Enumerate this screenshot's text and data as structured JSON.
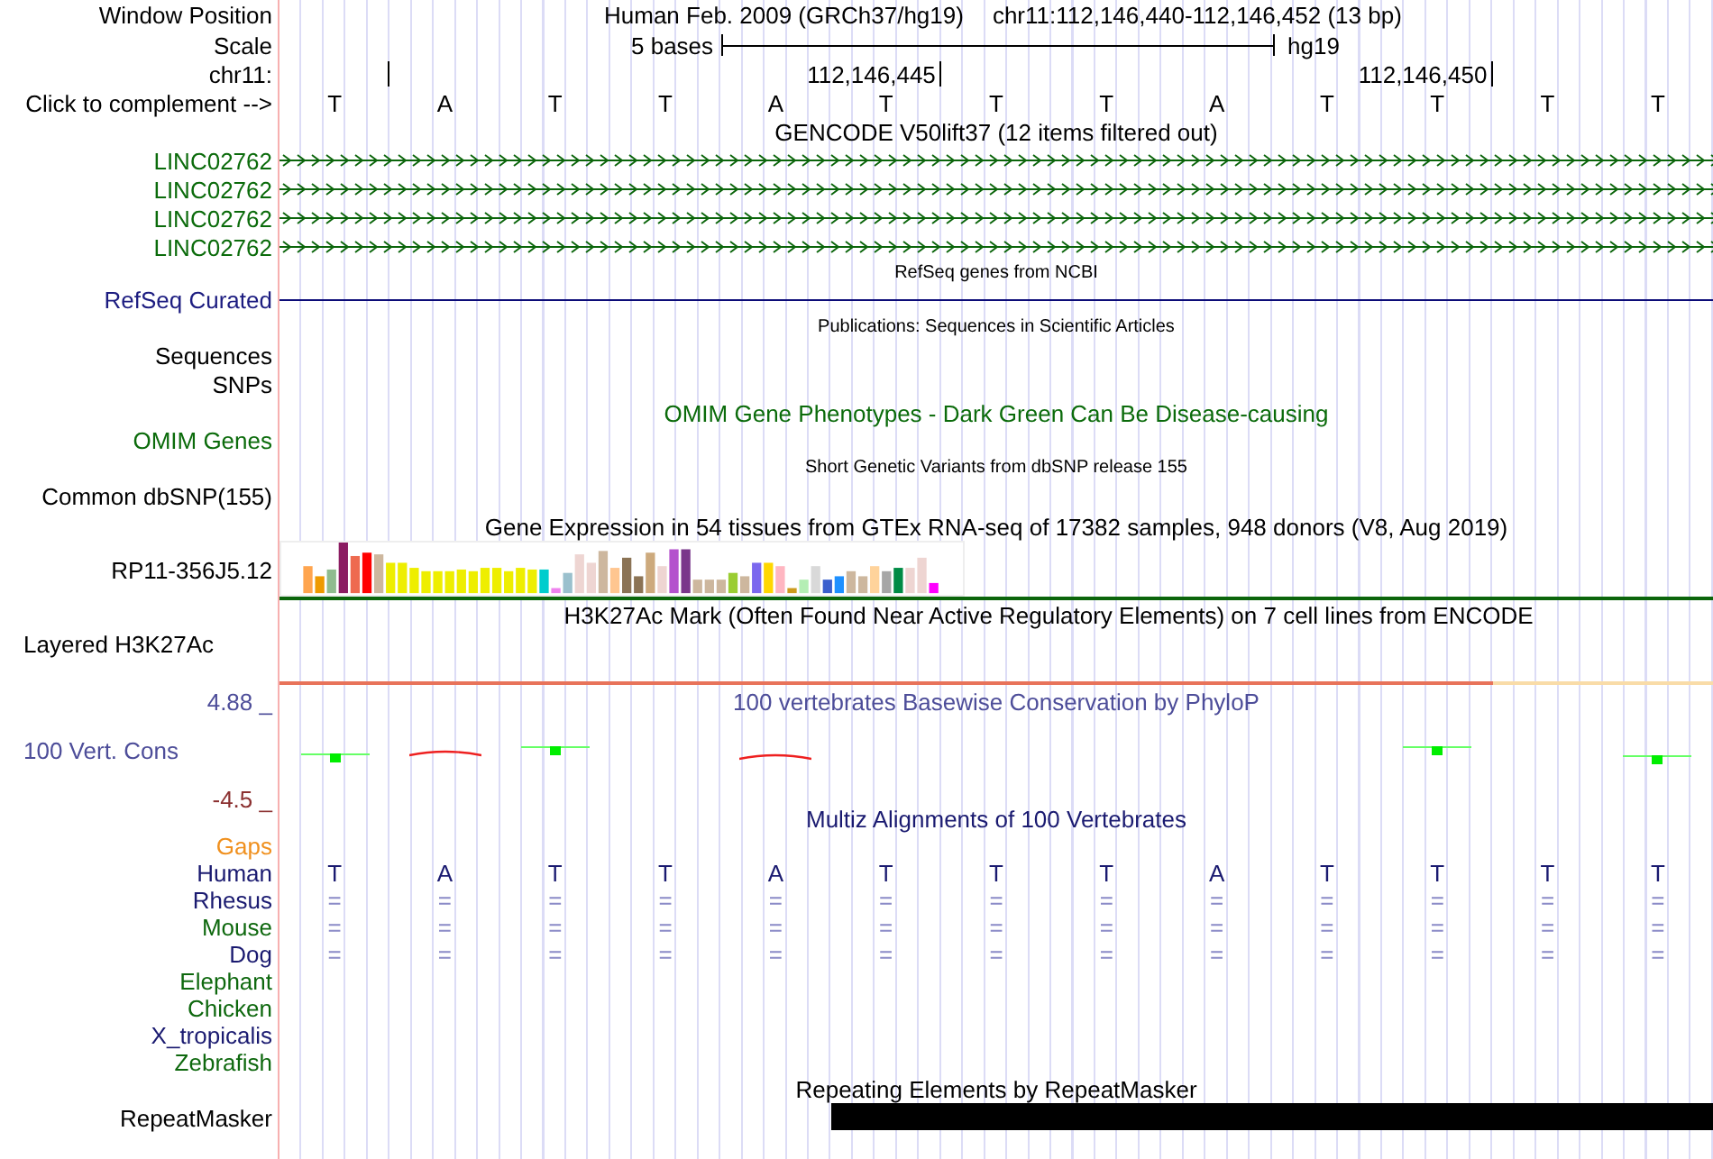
{
  "header": {
    "label": "Window Position",
    "assembly": "Human Feb. 2009 (GRCh37/hg19)",
    "range": "chr11:112,146,440-112,146,452 (13 bp)"
  },
  "scale": {
    "label": "Scale",
    "span": "5 bases",
    "assembly": "hg19"
  },
  "ruler": {
    "label": "chr11:",
    "tick_labels": [
      "112,146,445",
      "112,146,450"
    ]
  },
  "sequence": {
    "label": "Click to complement -->",
    "bases": [
      "T",
      "A",
      "T",
      "T",
      "A",
      "T",
      "T",
      "T",
      "A",
      "T",
      "T",
      "T",
      "T"
    ]
  },
  "gencode": {
    "title": "GENCODE V50lift37 (12 items filtered out)",
    "genes": [
      {
        "name": "LINC02762"
      },
      {
        "name": "LINC02762"
      },
      {
        "name": "LINC02762"
      },
      {
        "name": "LINC02762"
      }
    ]
  },
  "refseq": {
    "title": "RefSeq genes from NCBI",
    "label": "RefSeq Curated"
  },
  "publications": {
    "title": "Publications: Sequences in Scientific Articles",
    "labels": [
      "Sequences",
      "SNPs"
    ]
  },
  "omim": {
    "title": "OMIM Gene Phenotypes - Dark Green Can Be Disease-causing",
    "label": "OMIM Genes"
  },
  "dbsnp": {
    "title": "Short Genetic Variants from dbSNP release 155",
    "label": "Common dbSNP(155)"
  },
  "gtex": {
    "title": "Gene Expression in 54 tissues from GTEx RNA-seq of 17382 samples, 948 donors (V8, Aug 2019)",
    "label": "RP11-356J5.12"
  },
  "h3k27ac": {
    "title": "H3K27Ac Mark (Often Found Near Active Regulatory Elements) on 7 cell lines from ENCODE",
    "label": "Layered H3K27Ac"
  },
  "phylop": {
    "title": "100 vertebrates Basewise Conservation by PhyloP",
    "label": "100 Vert. Cons",
    "max": "4.88 _",
    "min": "-4.5 _"
  },
  "multiz": {
    "title": "Multiz Alignments of 100 Vertebrates",
    "gaps_label": "Gaps",
    "species": [
      {
        "name": "Human",
        "color": "#1a1a70",
        "bases": [
          "T",
          "A",
          "T",
          "T",
          "A",
          "T",
          "T",
          "T",
          "A",
          "T",
          "T",
          "T",
          "T"
        ]
      },
      {
        "name": "Rhesus",
        "color": "#1a1a70",
        "bases": [
          "=",
          "=",
          "=",
          "=",
          "=",
          "=",
          "=",
          "=",
          "=",
          "=",
          "=",
          "=",
          "="
        ]
      },
      {
        "name": "Mouse",
        "color": "#0e680e",
        "bases": [
          "=",
          "=",
          "=",
          "=",
          "=",
          "=",
          "=",
          "=",
          "=",
          "=",
          "=",
          "=",
          "="
        ]
      },
      {
        "name": "Dog",
        "color": "#1a1a70",
        "bases": [
          "=",
          "=",
          "=",
          "=",
          "=",
          "=",
          "=",
          "=",
          "=",
          "=",
          "=",
          "=",
          "="
        ]
      },
      {
        "name": "Elephant",
        "color": "#0e680e"
      },
      {
        "name": "Chicken",
        "color": "#0e680e"
      },
      {
        "name": "X_tropicalis",
        "color": "#1a1a70"
      },
      {
        "name": "Zebrafish",
        "color": "#0e680e"
      }
    ]
  },
  "repeatmasker": {
    "title": "Repeating Elements by RepeatMasker",
    "label": "RepeatMasker"
  }
}
